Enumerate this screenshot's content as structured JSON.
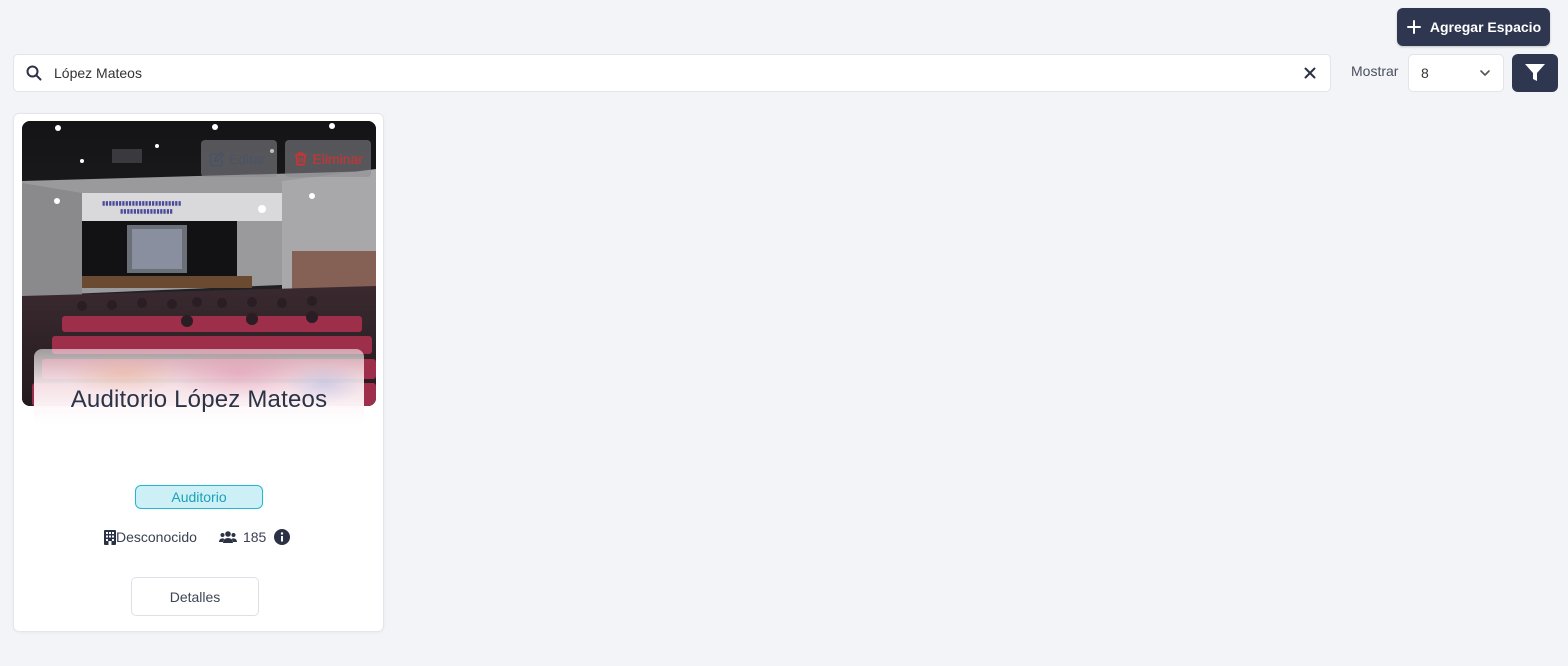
{
  "header": {
    "add_button_label": "Agregar Espacio"
  },
  "search": {
    "value": "López Mateos"
  },
  "pagination": {
    "show_label": "Mostrar",
    "page_size": "8"
  },
  "cards": [
    {
      "title": "Auditorio López Mateos",
      "edit_label": "Editar",
      "delete_label": "Eliminar",
      "category": "Auditorio",
      "building": "Desconocido",
      "capacity": "185",
      "details_label": "Detalles"
    }
  ],
  "colors": {
    "primary": "#2e3650",
    "badge_bg": "#cdf0f6",
    "badge_border": "#22b8cf",
    "danger": "#d43030"
  }
}
